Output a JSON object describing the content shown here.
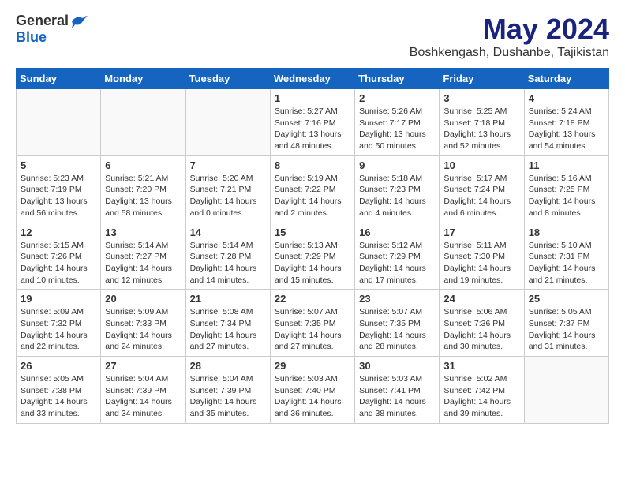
{
  "header": {
    "logo_general": "General",
    "logo_blue": "Blue",
    "month_title": "May 2024",
    "location": "Boshkengash, Dushanbe, Tajikistan"
  },
  "weekdays": [
    "Sunday",
    "Monday",
    "Tuesday",
    "Wednesday",
    "Thursday",
    "Friday",
    "Saturday"
  ],
  "weeks": [
    [
      {
        "day": "",
        "sunrise": "",
        "sunset": "",
        "daylight": "",
        "empty": true
      },
      {
        "day": "",
        "sunrise": "",
        "sunset": "",
        "daylight": "",
        "empty": true
      },
      {
        "day": "",
        "sunrise": "",
        "sunset": "",
        "daylight": "",
        "empty": true
      },
      {
        "day": "1",
        "sunrise": "Sunrise: 5:27 AM",
        "sunset": "Sunset: 7:16 PM",
        "daylight": "Daylight: 13 hours and 48 minutes."
      },
      {
        "day": "2",
        "sunrise": "Sunrise: 5:26 AM",
        "sunset": "Sunset: 7:17 PM",
        "daylight": "Daylight: 13 hours and 50 minutes."
      },
      {
        "day": "3",
        "sunrise": "Sunrise: 5:25 AM",
        "sunset": "Sunset: 7:18 PM",
        "daylight": "Daylight: 13 hours and 52 minutes."
      },
      {
        "day": "4",
        "sunrise": "Sunrise: 5:24 AM",
        "sunset": "Sunset: 7:18 PM",
        "daylight": "Daylight: 13 hours and 54 minutes."
      }
    ],
    [
      {
        "day": "5",
        "sunrise": "Sunrise: 5:23 AM",
        "sunset": "Sunset: 7:19 PM",
        "daylight": "Daylight: 13 hours and 56 minutes."
      },
      {
        "day": "6",
        "sunrise": "Sunrise: 5:21 AM",
        "sunset": "Sunset: 7:20 PM",
        "daylight": "Daylight: 13 hours and 58 minutes."
      },
      {
        "day": "7",
        "sunrise": "Sunrise: 5:20 AM",
        "sunset": "Sunset: 7:21 PM",
        "daylight": "Daylight: 14 hours and 0 minutes."
      },
      {
        "day": "8",
        "sunrise": "Sunrise: 5:19 AM",
        "sunset": "Sunset: 7:22 PM",
        "daylight": "Daylight: 14 hours and 2 minutes."
      },
      {
        "day": "9",
        "sunrise": "Sunrise: 5:18 AM",
        "sunset": "Sunset: 7:23 PM",
        "daylight": "Daylight: 14 hours and 4 minutes."
      },
      {
        "day": "10",
        "sunrise": "Sunrise: 5:17 AM",
        "sunset": "Sunset: 7:24 PM",
        "daylight": "Daylight: 14 hours and 6 minutes."
      },
      {
        "day": "11",
        "sunrise": "Sunrise: 5:16 AM",
        "sunset": "Sunset: 7:25 PM",
        "daylight": "Daylight: 14 hours and 8 minutes."
      }
    ],
    [
      {
        "day": "12",
        "sunrise": "Sunrise: 5:15 AM",
        "sunset": "Sunset: 7:26 PM",
        "daylight": "Daylight: 14 hours and 10 minutes."
      },
      {
        "day": "13",
        "sunrise": "Sunrise: 5:14 AM",
        "sunset": "Sunset: 7:27 PM",
        "daylight": "Daylight: 14 hours and 12 minutes."
      },
      {
        "day": "14",
        "sunrise": "Sunrise: 5:14 AM",
        "sunset": "Sunset: 7:28 PM",
        "daylight": "Daylight: 14 hours and 14 minutes."
      },
      {
        "day": "15",
        "sunrise": "Sunrise: 5:13 AM",
        "sunset": "Sunset: 7:29 PM",
        "daylight": "Daylight: 14 hours and 15 minutes."
      },
      {
        "day": "16",
        "sunrise": "Sunrise: 5:12 AM",
        "sunset": "Sunset: 7:29 PM",
        "daylight": "Daylight: 14 hours and 17 minutes."
      },
      {
        "day": "17",
        "sunrise": "Sunrise: 5:11 AM",
        "sunset": "Sunset: 7:30 PM",
        "daylight": "Daylight: 14 hours and 19 minutes."
      },
      {
        "day": "18",
        "sunrise": "Sunrise: 5:10 AM",
        "sunset": "Sunset: 7:31 PM",
        "daylight": "Daylight: 14 hours and 21 minutes."
      }
    ],
    [
      {
        "day": "19",
        "sunrise": "Sunrise: 5:09 AM",
        "sunset": "Sunset: 7:32 PM",
        "daylight": "Daylight: 14 hours and 22 minutes."
      },
      {
        "day": "20",
        "sunrise": "Sunrise: 5:09 AM",
        "sunset": "Sunset: 7:33 PM",
        "daylight": "Daylight: 14 hours and 24 minutes."
      },
      {
        "day": "21",
        "sunrise": "Sunrise: 5:08 AM",
        "sunset": "Sunset: 7:34 PM",
        "daylight": "Daylight: 14 hours and 27 minutes."
      },
      {
        "day": "22",
        "sunrise": "Sunrise: 5:07 AM",
        "sunset": "Sunset: 7:35 PM",
        "daylight": "Daylight: 14 hours and 27 minutes."
      },
      {
        "day": "23",
        "sunrise": "Sunrise: 5:07 AM",
        "sunset": "Sunset: 7:35 PM",
        "daylight": "Daylight: 14 hours and 28 minutes."
      },
      {
        "day": "24",
        "sunrise": "Sunrise: 5:06 AM",
        "sunset": "Sunset: 7:36 PM",
        "daylight": "Daylight: 14 hours and 30 minutes."
      },
      {
        "day": "25",
        "sunrise": "Sunrise: 5:05 AM",
        "sunset": "Sunset: 7:37 PM",
        "daylight": "Daylight: 14 hours and 31 minutes."
      }
    ],
    [
      {
        "day": "26",
        "sunrise": "Sunrise: 5:05 AM",
        "sunset": "Sunset: 7:38 PM",
        "daylight": "Daylight: 14 hours and 33 minutes."
      },
      {
        "day": "27",
        "sunrise": "Sunrise: 5:04 AM",
        "sunset": "Sunset: 7:39 PM",
        "daylight": "Daylight: 14 hours and 34 minutes."
      },
      {
        "day": "28",
        "sunrise": "Sunrise: 5:04 AM",
        "sunset": "Sunset: 7:39 PM",
        "daylight": "Daylight: 14 hours and 35 minutes."
      },
      {
        "day": "29",
        "sunrise": "Sunrise: 5:03 AM",
        "sunset": "Sunset: 7:40 PM",
        "daylight": "Daylight: 14 hours and 36 minutes."
      },
      {
        "day": "30",
        "sunrise": "Sunrise: 5:03 AM",
        "sunset": "Sunset: 7:41 PM",
        "daylight": "Daylight: 14 hours and 38 minutes."
      },
      {
        "day": "31",
        "sunrise": "Sunrise: 5:02 AM",
        "sunset": "Sunset: 7:42 PM",
        "daylight": "Daylight: 14 hours and 39 minutes."
      },
      {
        "day": "",
        "sunrise": "",
        "sunset": "",
        "daylight": "",
        "empty": true
      }
    ]
  ]
}
